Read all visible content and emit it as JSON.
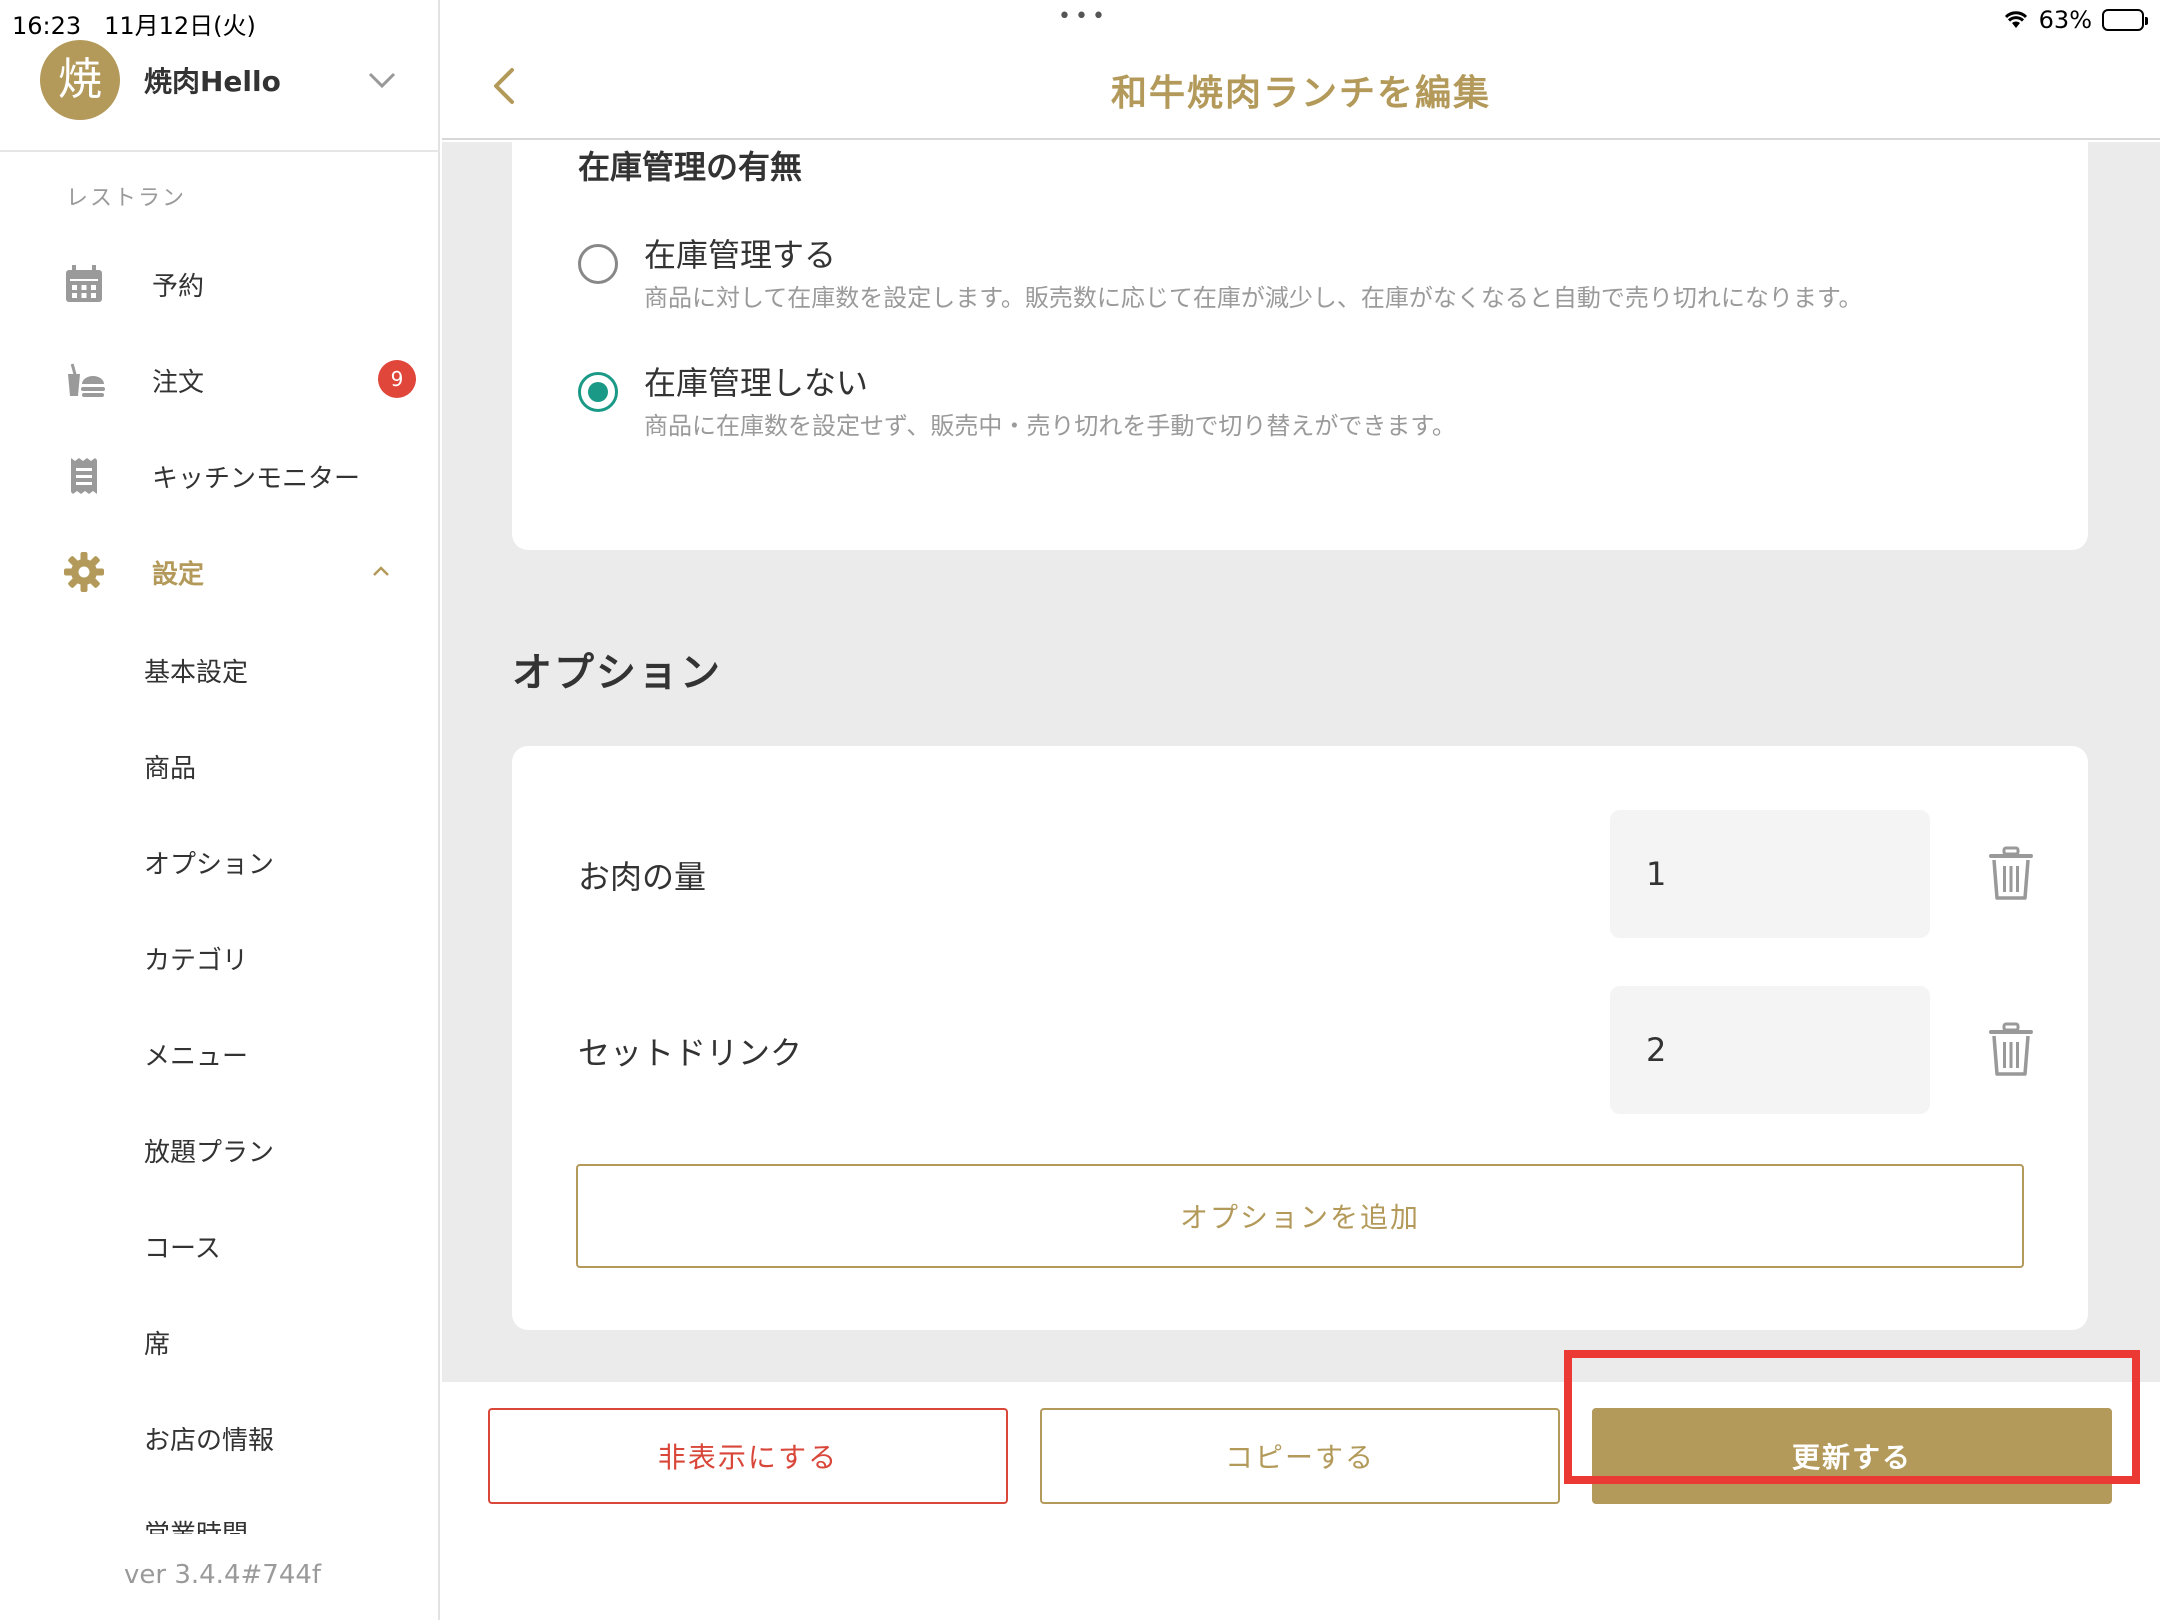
{
  "status_bar": {
    "time": "16:23",
    "date": "11月12日(火)",
    "dots": "•••",
    "battery": "63%",
    "battery_level": 0.63
  },
  "account": {
    "avatar_text": "焼",
    "name": "焼肉Hello"
  },
  "sidebar": {
    "section_label": "レストラン",
    "items": [
      {
        "label": "予約",
        "icon": "calendar-icon"
      },
      {
        "label": "注文",
        "icon": "order-icon",
        "badge": "9"
      },
      {
        "label": "キッチンモニター",
        "icon": "receipt-icon"
      },
      {
        "label": "設定",
        "icon": "gear-icon",
        "active": true
      }
    ],
    "sub_items": [
      "基本設定",
      "商品",
      "オプション",
      "カテゴリ",
      "メニュー",
      "放題プラン",
      "コース",
      "席",
      "お店の情報",
      "営業時間"
    ],
    "version": "ver 3.4.4#744f"
  },
  "header": {
    "title": "和牛焼肉ランチを編集"
  },
  "stock": {
    "title": "在庫管理の有無",
    "options": [
      {
        "label": "在庫管理する",
        "desc": "商品に対して在庫数を設定します。販売数に応じて在庫が減少し、在庫がなくなると自動で売り切れになります。",
        "checked": false
      },
      {
        "label": "在庫管理しない",
        "desc": "商品に在庫数を設定せず、販売中・売り切れを手動で切り替えができます。",
        "checked": true
      }
    ]
  },
  "options": {
    "heading": "オプション",
    "rows": [
      {
        "name": "お肉の量",
        "qty": "1"
      },
      {
        "name": "セットドリンク",
        "qty": "2"
      }
    ],
    "add_label": "オプションを追加"
  },
  "footer": {
    "hide_label": "非表示にする",
    "copy_label": "コピーする",
    "update_label": "更新する"
  },
  "colors": {
    "accent": "#b39a5a",
    "danger": "#d9463a",
    "radio_checked": "#1a9a86",
    "badge": "#e0463a",
    "highlight": "#ea3a33"
  }
}
